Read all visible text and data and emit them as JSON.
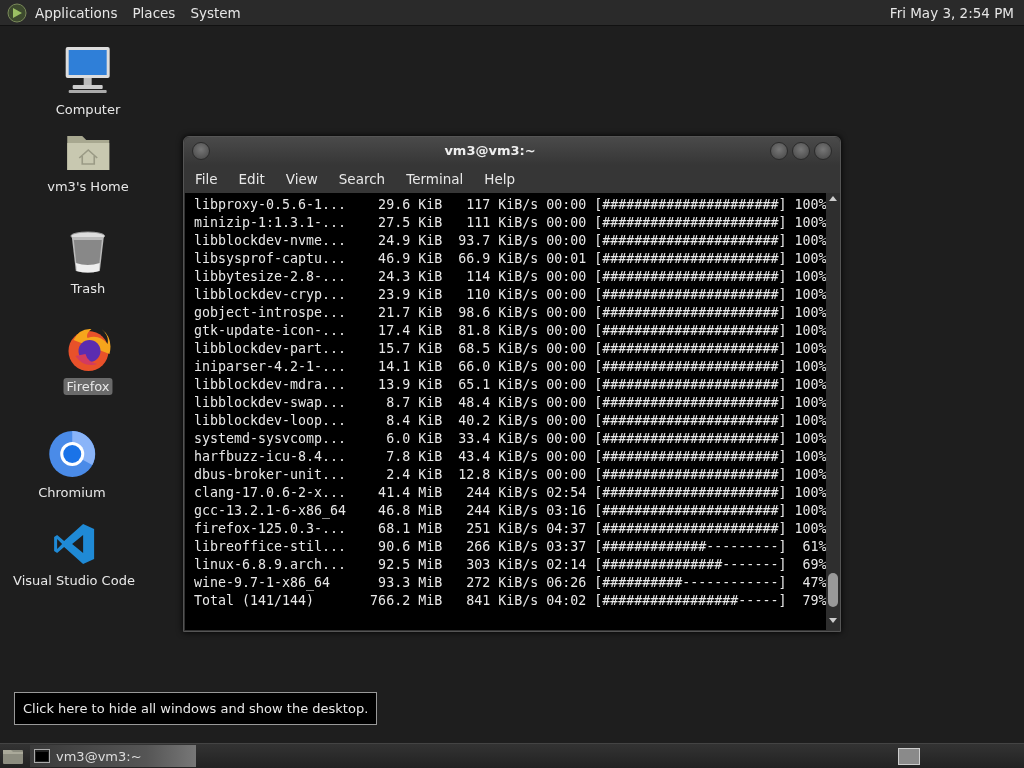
{
  "top_panel": {
    "menus": [
      "Applications",
      "Places",
      "System"
    ],
    "clock": "Fri May 3, 2:54 PM"
  },
  "desktop_icons": [
    {
      "kind": "computer",
      "label": "Computer",
      "selected": false
    },
    {
      "kind": "home",
      "label": "vm3's Home",
      "selected": false
    },
    {
      "kind": "trash",
      "label": "Trash",
      "selected": false
    },
    {
      "kind": "firefox",
      "label": "Firefox",
      "selected": true
    },
    {
      "kind": "chromium",
      "label": "Chromium",
      "selected": false
    },
    {
      "kind": "vscode",
      "label": "Visual Studio Code",
      "selected": false
    }
  ],
  "terminal": {
    "title": "vm3@vm3:~",
    "menu": [
      "File",
      "Edit",
      "View",
      "Search",
      "Terminal",
      "Help"
    ],
    "lines": [
      "libproxy-0.5.6-1...    29.6 KiB   117 KiB/s 00:00 [######################] 100%",
      "minizip-1:1.3.1-...    27.5 KiB   111 KiB/s 00:00 [######################] 100%",
      "libblockdev-nvme...    24.9 KiB  93.7 KiB/s 00:00 [######################] 100%",
      "libsysprof-captu...    46.9 KiB  66.9 KiB/s 00:01 [######################] 100%",
      "libbytesize-2.8-...    24.3 KiB   114 KiB/s 00:00 [######################] 100%",
      "libblockdev-cryp...    23.9 KiB   110 KiB/s 00:00 [######################] 100%",
      "gobject-introspe...    21.7 KiB  98.6 KiB/s 00:00 [######################] 100%",
      "gtk-update-icon-...    17.4 KiB  81.8 KiB/s 00:00 [######################] 100%",
      "libblockdev-part...    15.7 KiB  68.5 KiB/s 00:00 [######################] 100%",
      "iniparser-4.2-1-...    14.1 KiB  66.0 KiB/s 00:00 [######################] 100%",
      "libblockdev-mdra...    13.9 KiB  65.1 KiB/s 00:00 [######################] 100%",
      "libblockdev-swap...     8.7 KiB  48.4 KiB/s 00:00 [######################] 100%",
      "libblockdev-loop...     8.4 KiB  40.2 KiB/s 00:00 [######################] 100%",
      "systemd-sysvcomp...     6.0 KiB  33.4 KiB/s 00:00 [######################] 100%",
      "harfbuzz-icu-8.4...     7.8 KiB  43.4 KiB/s 00:00 [######################] 100%",
      "dbus-broker-unit...     2.4 KiB  12.8 KiB/s 00:00 [######################] 100%",
      "clang-17.0.6-2-x...    41.4 MiB   244 KiB/s 02:54 [######################] 100%",
      "gcc-13.2.1-6-x86_64    46.8 MiB   244 KiB/s 03:16 [######################] 100%",
      "firefox-125.0.3-...    68.1 MiB   251 KiB/s 04:37 [######################] 100%",
      "libreoffice-stil...    90.6 MiB   266 KiB/s 03:37 [#############---------]  61%",
      "linux-6.8.9.arch...    92.5 MiB   303 KiB/s 02:14 [###############-------]  69%",
      "wine-9.7-1-x86_64      93.3 MiB   272 KiB/s 06:26 [##########------------]  47%",
      "Total (141/144)       766.2 MiB   841 KiB/s 04:02 [#################-----]  79%"
    ]
  },
  "tooltip": "Click here to hide all windows and show the desktop.",
  "bottom_panel": {
    "tasks": [
      {
        "label": "vm3@vm3:~"
      }
    ]
  }
}
